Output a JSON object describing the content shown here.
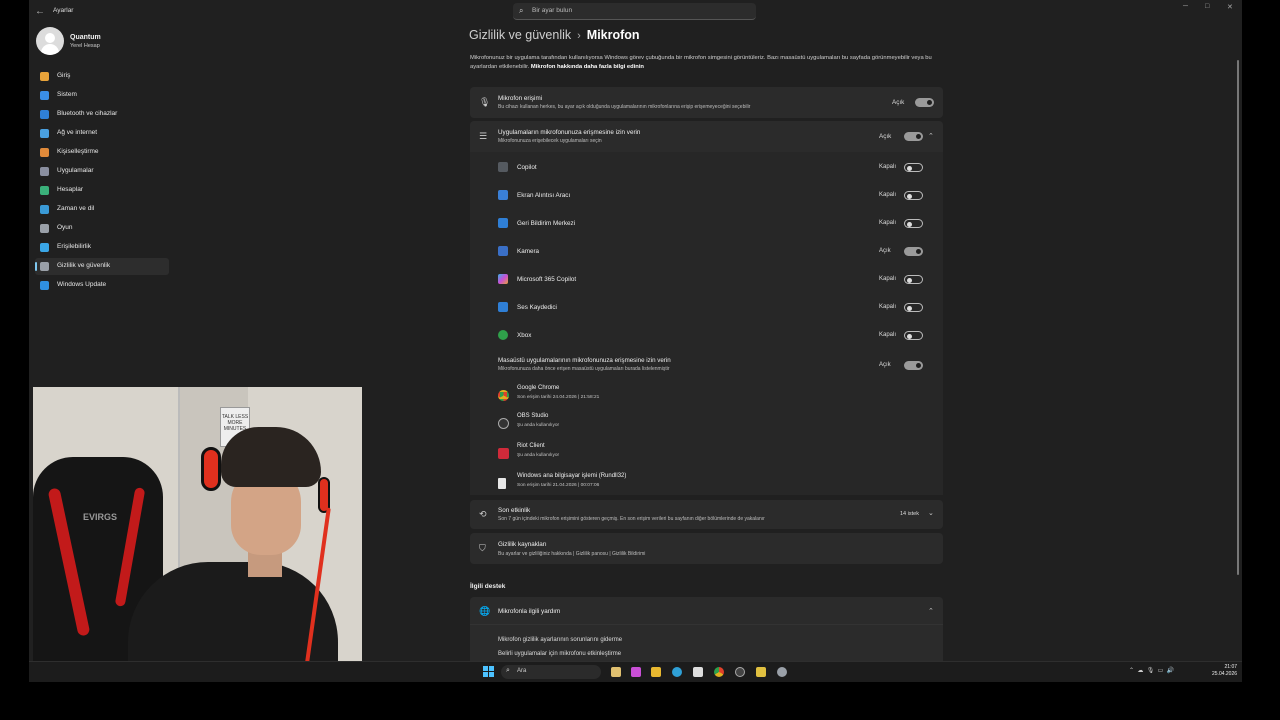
{
  "window": {
    "title": "Ayarlar",
    "search_placeholder": "Bir ayar bulun"
  },
  "user": {
    "name": "Quantum",
    "account_type": "Yerel Hesap"
  },
  "sidebar": {
    "items": [
      {
        "label": "Giriş",
        "icon": "home-icon",
        "color": "#e8a33a"
      },
      {
        "label": "Sistem",
        "icon": "system-icon",
        "color": "#3a8ee6"
      },
      {
        "label": "Bluetooth ve cihazlar",
        "icon": "bluetooth-icon",
        "color": "#2f7fd6"
      },
      {
        "label": "Ağ ve internet",
        "icon": "network-icon",
        "color": "#4aa0e0"
      },
      {
        "label": "Kişiselleştirme",
        "icon": "brush-icon",
        "color": "#e08a3a"
      },
      {
        "label": "Uygulamalar",
        "icon": "apps-icon",
        "color": "#8a8fa0"
      },
      {
        "label": "Hesaplar",
        "icon": "account-icon",
        "color": "#3ab07a"
      },
      {
        "label": "Zaman ve dil",
        "icon": "globe-icon",
        "color": "#3a9ad6"
      },
      {
        "label": "Oyun",
        "icon": "gamepad-icon",
        "color": "#9aa0a8"
      },
      {
        "label": "Erişilebilirlik",
        "icon": "accessibility-icon",
        "color": "#3aa6e6"
      },
      {
        "label": "Gizlilik ve güvenlik",
        "icon": "shield-icon",
        "color": "#9aa0a8"
      },
      {
        "label": "Windows Update",
        "icon": "update-icon",
        "color": "#2f8fe0"
      }
    ]
  },
  "breadcrumb": {
    "parent": "Gizlilik ve güvenlik",
    "separator": "›",
    "current": "Mikrofon"
  },
  "description": {
    "text": "Mikrofonunuz bir uygulama tarafından kullanılıyorsa Windows görev çubuğunda bir mikrofon simgesini görüntüleriz. Bazı masaüstü uygulamaları bu sayfada görünmeyebilir veya bu ayarlardan etkilenebilir.",
    "link": "Mikrofon hakkında daha fazla bilgi edinin"
  },
  "mic_access": {
    "title": "Mikrofon erişimi",
    "subtitle": "Bu cihazı kullanan herkes, bu ayar açık olduğunda uygulamalarının mikrofonlarına erişip erişemeyeceğini seçebilir",
    "state": "Açık"
  },
  "app_access": {
    "title": "Uygulamaların mikrofonunuza erişmesine izin verin",
    "subtitle": "Mikrofonunuza erişebilecek uygulamaları seçin",
    "state": "Açık"
  },
  "apps": [
    {
      "name": "Copilot",
      "state": "Kapalı",
      "on": false,
      "color": "#555a60"
    },
    {
      "name": "Ekran Alıntısı Aracı",
      "state": "Kapalı",
      "on": false,
      "color": "#3a7fd6"
    },
    {
      "name": "Geri Bildirim Merkezi",
      "state": "Kapalı",
      "on": false,
      "color": "#2f7fd6"
    },
    {
      "name": "Kamera",
      "state": "Açık",
      "on": true,
      "color": "#3a6fc6"
    },
    {
      "name": "Microsoft 365 Copilot",
      "state": "Kapalı",
      "on": false,
      "color": "#c94fd6"
    },
    {
      "name": "Ses Kaydedici",
      "state": "Kapalı",
      "on": false,
      "color": "#2f7fd6"
    },
    {
      "name": "Xbox",
      "state": "Kapalı",
      "on": false,
      "color": "#2fa04a"
    }
  ],
  "desktop_access": {
    "title": "Masaüstü uygulamalarının mikrofonunuza erişmesine izin verin",
    "subtitle": "Mikrofonunuza daha önce erişen masaüstü uygulamaları burada listelenmiştir",
    "state": "Açık",
    "apps": [
      {
        "name": "Google Chrome",
        "detail": "Son erişim tarihi 24.04.2026 | 21:58:21",
        "color": "#e0b020"
      },
      {
        "name": "OBS Studio",
        "detail": "Şu anda kullanılıyor",
        "color": "#444444"
      },
      {
        "name": "Riot Client",
        "detail": "Şu anda kullanılıyor",
        "color": "#d02a3a"
      },
      {
        "name": "Windows ana bilgisayar işlemi (Rundll32)",
        "detail": "Son erişim tarihi 21.04.2026 | 00:07:06",
        "color": "#e8e8e8"
      }
    ]
  },
  "recent_activity": {
    "title": "Son etkinlik",
    "subtitle": "Son 7 gün içindeki mikrofon erişimini gösteren geçmiş. En son erişim verileri bu sayfanın diğer bölümlerinde de yakalanır",
    "count": "14 istek"
  },
  "privacy_resources": {
    "title": "Gizlilik kaynakları",
    "subtitle": "Bu ayarlar ve gizliliğiniz hakkında | Gizlilik panosu | Gizlilik Bildirimi"
  },
  "related": {
    "heading": "İlgili destek",
    "card_title": "Mikrofonla ilgili yardım",
    "links": [
      "Mikrofon gizlilik ayarlarının sorunlarını giderme",
      "Belirli uygulamalar için mikrofonu etkinleştirme"
    ]
  },
  "webcam": {
    "poster_text": "TALK LESS MORE MINUTES",
    "chair_logo": "EVIRGS"
  },
  "taskbar": {
    "search_label": "Ara",
    "time": "21:07",
    "date": "25.04.2026"
  }
}
